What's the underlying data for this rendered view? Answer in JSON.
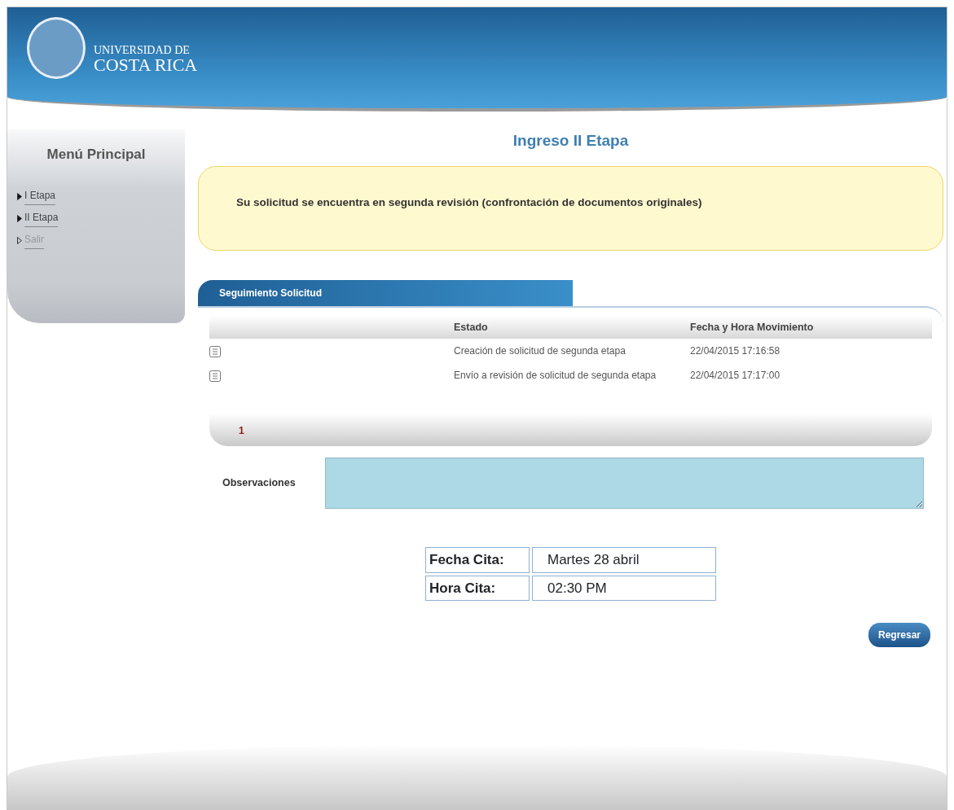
{
  "header": {
    "logo_line_1": "UNIVERSIDAD DE",
    "logo_line_2": "COSTA RICA"
  },
  "sidebar": {
    "title": "Menú Principal",
    "items": [
      {
        "label": "I Etapa",
        "disabled": false
      },
      {
        "label": "II Etapa",
        "disabled": false
      },
      {
        "label": "Salir",
        "disabled": true
      }
    ]
  },
  "page_title": "Ingreso II Etapa",
  "alert": "Su solicitud se encuentra en segunda revisión (confrontación de documentos originales)",
  "tracking": {
    "tab": "Seguimiento Solicitud",
    "columns": [
      "Estado",
      "Fecha y Hora Movimiento"
    ],
    "rows": [
      {
        "estado": "Creación de solicitud de segunda etapa",
        "fecha": "22/04/2015 17:16:58"
      },
      {
        "estado": "Envío a revisión de solicitud de segunda etapa",
        "fecha": "22/04/2015 17:17:00"
      }
    ],
    "pages": [
      {
        "label": "1",
        "selected": true
      }
    ]
  },
  "observaciones": {
    "label": "Observaciones"
  },
  "cita": [
    {
      "label": "Fecha Cita:",
      "value": "Martes 28 abril"
    },
    {
      "label": "Hora Cita:",
      "value": "02:30 PM"
    }
  ],
  "buttons": [
    "Regresar"
  ]
}
